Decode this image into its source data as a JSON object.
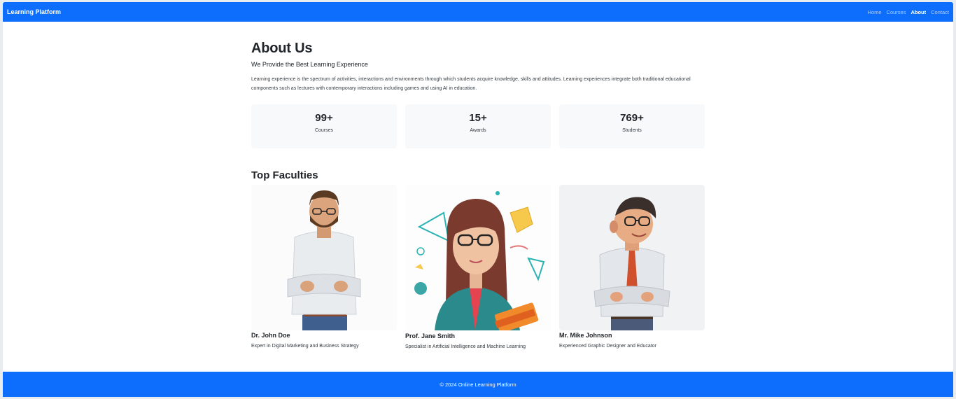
{
  "navbar": {
    "brand": "Learning Platform",
    "links": [
      "Home",
      "Courses",
      "About",
      "Contact"
    ],
    "active": "About"
  },
  "about": {
    "title": "About Us",
    "subtitle": "We Provide the Best Learning Experience",
    "intro": "Learning experience is the spectrum of activities, interactions and environments through which students acquire knowledge, skills and attitudes. Learning experiences integrate both traditional educational components such as lectures with contemporary interactions including games and using AI in education."
  },
  "stats": [
    {
      "value": "99+",
      "label": "Courses"
    },
    {
      "value": "15+",
      "label": "Awards"
    },
    {
      "value": "769+",
      "label": "Students"
    }
  ],
  "faculties": {
    "title": "Top Faculties",
    "members": [
      {
        "name": "Dr. John Doe",
        "desc": "Expert in Digital Marketing and Business Strategy",
        "image": "bearded-man-avatar"
      },
      {
        "name": "Prof. Jane Smith",
        "desc": "Specialist in Artificial Intelligence and Machine Learning",
        "image": "woman-with-books-avatar"
      },
      {
        "name": "Mr. Mike Johnson",
        "desc": "Experienced Graphic Designer and Educator",
        "image": "man-with-tie-avatar"
      }
    ]
  },
  "footer": {
    "text": "© 2024 Online Learning Platform"
  },
  "colors": {
    "primary": "#0d6efd",
    "card_bg": "#f8f9fa"
  }
}
